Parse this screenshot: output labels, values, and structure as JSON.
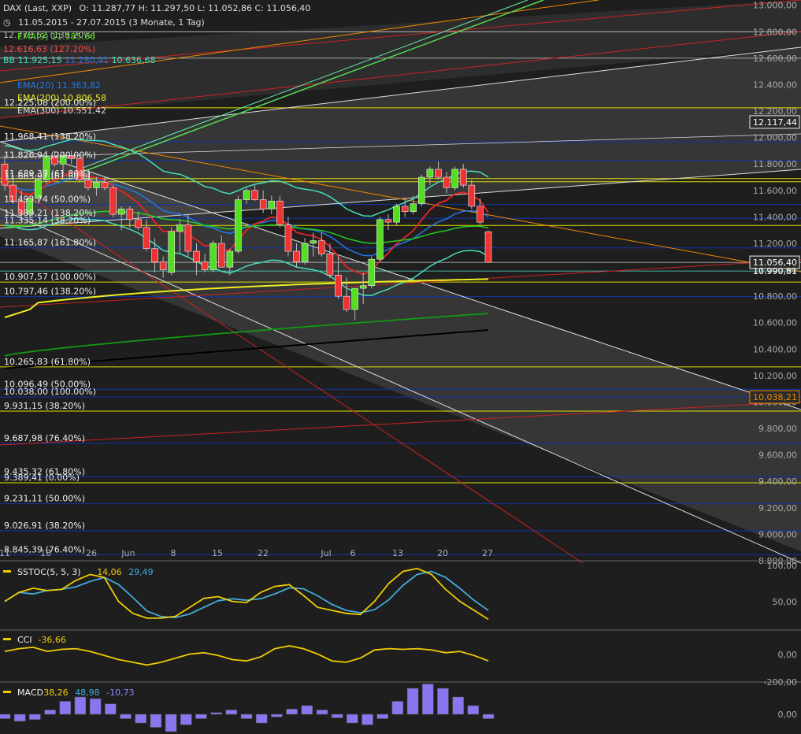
{
  "header": {
    "instrument": "DAX (Last, XXP)",
    "ohlc": "O: 11.287,77  H: 11.297,50  L: 11.052,86  C: 11.056,40",
    "range": "11.05.2015 - 27.07.2015 (3 Monate, 1 Tag)"
  },
  "legend": {
    "bb_label": "BB",
    "bb_values": [
      "11.925,15",
      "11.280,91",
      "10.636,68"
    ],
    "ema20": "EMA(20)  11.363,82",
    "ema200": "EMA(200)  10.806,58",
    "ema300": "EMA(300)  10.551,42",
    "ema_top": "EMA(9)  11.385,66",
    "fib_red": "12.616,63 (127.20%)",
    "fib_top": "12.778,62 (138.20%)"
  },
  "colors": {
    "bg": "#1e1e1e",
    "up": "#55dd22",
    "down": "#ee3333",
    "bb": "#44ddbb",
    "ema9": "#ee2222",
    "ema20": "#2277ee",
    "ema50": "#22cc22",
    "ema200": "#eeee22",
    "ema300": "#111111",
    "hline_yellow": "#dddd00",
    "hline_blue": "#1133aa"
  },
  "price_axis": [
    "13.000,00",
    "12.800,00",
    "12.600,00",
    "12.400,00",
    "12.200,00",
    "12.000,00",
    "11.800,00",
    "11.600,00",
    "11.400,00",
    "11.200,00",
    "11.000,00",
    "10.800,00",
    "10.600,00",
    "10.400,00",
    "10.200,00",
    "10.000,00",
    "9.800,00",
    "9.600,00",
    "9.400,00",
    "9.200,00",
    "9.000,00",
    "8.800,00"
  ],
  "price_tags": [
    {
      "text": "12.117,44",
      "value": 12117.44,
      "style": "white"
    },
    {
      "text": "11.056,40",
      "value": 11056.4,
      "style": "white"
    },
    {
      "text": "10.990,81",
      "value": 10990.81,
      "style": "plain"
    },
    {
      "text": "10.038,21",
      "value": 10038.21,
      "style": "orange"
    }
  ],
  "date_axis": [
    "11",
    "18",
    "26",
    "Jun",
    "8",
    "15",
    "22",
    "Jul",
    "6",
    "13",
    "20",
    "27"
  ],
  "fib_levels": [
    {
      "text": "12.225,08 (200.00%)",
      "value": 12225.08,
      "color": "yellow"
    },
    {
      "text": "11.968,41 (138.20%)",
      "value": 11968.41,
      "color": "blue"
    },
    {
      "text": "11.826,94 (200.00%)",
      "value": 11826.94,
      "color": "blue"
    },
    {
      "text": "11.689,37 (61.80%)",
      "value": 11689.37,
      "color": "yellow"
    },
    {
      "text": "11.665,97 (61.80%)",
      "value": 11665.97,
      "color": "yellow"
    },
    {
      "text": "11.493,74 (50.00%)",
      "value": 11493.74,
      "color": "blue"
    },
    {
      "text": "11.389,21 (138.20%)",
      "value": 11389.21,
      "color": "blue"
    },
    {
      "text": "11.335,14 (38.20%)",
      "value": 11335.14,
      "color": "yellow"
    },
    {
      "text": "11.165,87 (161.80%)",
      "value": 11165.87,
      "color": "blue"
    },
    {
      "text": "10.907,57 (100.00%)",
      "value": 10907.57,
      "color": "yellow"
    },
    {
      "text": "10.797,46 (138.20%)",
      "value": 10797.46,
      "color": "blue"
    },
    {
      "text": "10.265,83 (61.80%)",
      "value": 10265.83,
      "color": "yellow"
    },
    {
      "text": "10.096,49 (50.00%)",
      "value": 10096.49,
      "color": "blue"
    },
    {
      "text": "10.038,00 (100.00%)",
      "value": 10038,
      "color": "blue"
    },
    {
      "text": "9.931,15 (38.20%)",
      "value": 9931.15,
      "color": "yellow"
    },
    {
      "text": "9.687,98 (76.40%)",
      "value": 9687.98,
      "color": "blue"
    },
    {
      "text": "9.435,32 (61.80%)",
      "value": 9435.32,
      "color": "blue"
    },
    {
      "text": "9.389,41 (0.00%)",
      "value": 9389.41,
      "color": "yellow"
    },
    {
      "text": "9.231,11 (50.00%)",
      "value": 9231.11,
      "color": "blue"
    },
    {
      "text": "9.026,91 (38.20%)",
      "value": 9026.91,
      "color": "blue"
    },
    {
      "text": "8.845,39 (76.40%)",
      "value": 8845.39,
      "color": "blue"
    }
  ],
  "chart_data": {
    "type": "candlestick",
    "title": "DAX (Last, XXP)",
    "ylim": [
      8800,
      13040
    ],
    "candles": [
      [
        11800,
        11870,
        11600,
        11640
      ],
      [
        11640,
        11700,
        11500,
        11520
      ],
      [
        11520,
        11600,
        11380,
        11420
      ],
      [
        11420,
        11560,
        11400,
        11540
      ],
      [
        11540,
        11720,
        11500,
        11680
      ],
      [
        11680,
        11900,
        11650,
        11860
      ],
      [
        11860,
        11900,
        11780,
        11800
      ],
      [
        11800,
        11880,
        11720,
        11860
      ],
      [
        11860,
        11900,
        11800,
        11840
      ],
      [
        11840,
        11880,
        11660,
        11680
      ],
      [
        11680,
        11760,
        11600,
        11620
      ],
      [
        11620,
        11700,
        11560,
        11660
      ],
      [
        11660,
        11700,
        11600,
        11620
      ],
      [
        11620,
        11640,
        11400,
        11420
      ],
      [
        11420,
        11480,
        11300,
        11460
      ],
      [
        11460,
        11480,
        11320,
        11380
      ],
      [
        11380,
        11440,
        11300,
        11320
      ],
      [
        11320,
        11380,
        11140,
        11160
      ],
      [
        11160,
        11240,
        10980,
        11060
      ],
      [
        11060,
        11100,
        10940,
        11000
      ],
      [
        10980,
        11320,
        10960,
        11290
      ],
      [
        11290,
        11380,
        11120,
        11340
      ],
      [
        11340,
        11420,
        11100,
        11140
      ],
      [
        11140,
        11200,
        10960,
        11060
      ],
      [
        11060,
        11120,
        10980,
        11000
      ],
      [
        11000,
        11220,
        10980,
        11200
      ],
      [
        11200,
        11260,
        11020,
        11020
      ],
      [
        11020,
        11160,
        10960,
        11140
      ],
      [
        11140,
        11560,
        11120,
        11530
      ],
      [
        11530,
        11620,
        11500,
        11600
      ],
      [
        11600,
        11640,
        11520,
        11530
      ],
      [
        11530,
        11600,
        11430,
        11460
      ],
      [
        11460,
        11560,
        11420,
        11520
      ],
      [
        11520,
        11560,
        11320,
        11340
      ],
      [
        11340,
        11400,
        11100,
        11140
      ],
      [
        11140,
        11200,
        11020,
        11060
      ],
      [
        11060,
        11240,
        11040,
        11200
      ],
      [
        11200,
        11280,
        11100,
        11220
      ],
      [
        11220,
        11280,
        11100,
        11120
      ],
      [
        11120,
        11200,
        10940,
        10960
      ],
      [
        10960,
        11100,
        10780,
        10800
      ],
      [
        10800,
        10940,
        10680,
        10700
      ],
      [
        10700,
        10860,
        10620,
        10860
      ],
      [
        10860,
        10980,
        10740,
        10880
      ],
      [
        10880,
        11100,
        10860,
        11080
      ],
      [
        11080,
        11400,
        11060,
        11380
      ],
      [
        11380,
        11420,
        11300,
        11360
      ],
      [
        11360,
        11500,
        11340,
        11480
      ],
      [
        11480,
        11540,
        11400,
        11440
      ],
      [
        11440,
        11560,
        11420,
        11500
      ],
      [
        11500,
        11720,
        11480,
        11700
      ],
      [
        11700,
        11780,
        11640,
        11760
      ],
      [
        11760,
        11820,
        11680,
        11700
      ],
      [
        11700,
        11740,
        11580,
        11620
      ],
      [
        11620,
        11780,
        11600,
        11760
      ],
      [
        11760,
        11800,
        11620,
        11640
      ],
      [
        11640,
        11680,
        11460,
        11480
      ],
      [
        11480,
        11540,
        11340,
        11360
      ],
      [
        11287.77,
        11297.5,
        11052.86,
        11056.4
      ]
    ]
  },
  "sstoc": {
    "label": "SSTOC(5, 5, 3)",
    "v1": "14,06",
    "v2": "29,49",
    "axis": [
      "100,00",
      "50,00"
    ]
  },
  "cci": {
    "label": "CCI",
    "v1": "-36,66",
    "axis": [
      "0,00",
      "-200,00"
    ]
  },
  "macd": {
    "label": "MACD",
    "v1": "38,26",
    "v2": "48,98",
    "v3": "-10,73",
    "axis": [
      "0,00"
    ]
  }
}
